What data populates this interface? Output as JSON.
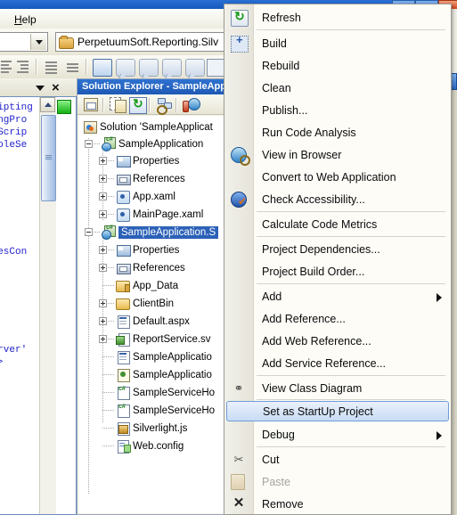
{
  "window": {
    "titlebar_buttons": [
      "minimize",
      "maximize",
      "close"
    ]
  },
  "menubar": {
    "items": [
      {
        "label": "Help",
        "accesskey": "H"
      }
    ]
  },
  "toolbar_file": {
    "combo_value": "",
    "file_icon": "folder-icon",
    "file_name": "PerpetuumSoft.Reporting.Silv"
  },
  "toolbar_icons": [
    {
      "name": "outdent-icon"
    },
    {
      "name": "indent-icon"
    },
    {
      "name": "comment-lines-icon"
    },
    {
      "name": "uncomment-icon"
    },
    {
      "name": "new-window-icon"
    },
    {
      "name": "navigate-backward-icon"
    },
    {
      "name": "navigate-forward-icon"
    },
    {
      "name": "previous-bookmark-icon"
    },
    {
      "name": "next-bookmark-icon"
    },
    {
      "name": "go-to-definition-icon"
    },
    {
      "name": "go-to-declaration-icon"
    }
  ],
  "editor": {
    "panel_caret": "dropdown-caret",
    "panel_close": "×",
    "code_lines": [
      "cripting",
      "tingPro",
      "n.Scrip",
      "gRoleSe",
      "icesCon",
      "Server'",
      "'>"
    ],
    "green_indicator": "green-status-square",
    "scroll_up": "scroll-up-arrow"
  },
  "solution_explorer": {
    "title": "Solution Explorer - SampleApp",
    "toolbar": [
      {
        "name": "properties-window-icon"
      },
      {
        "name": "show-all-files-icon"
      },
      {
        "name": "refresh-icon"
      },
      {
        "name": "view-class-diagram-icon"
      },
      {
        "name": "view-designer-icon"
      }
    ],
    "tree": [
      {
        "label": "Solution 'SampleApplicat",
        "icon": "solution-icon",
        "depth": 0,
        "expander": "none",
        "selected": false
      },
      {
        "label": "SampleApplication",
        "icon": "silverlight-project-icon",
        "depth": 1,
        "expander": "minus",
        "selected": false
      },
      {
        "label": "Properties",
        "icon": "properties-icon",
        "depth": 2,
        "expander": "plus",
        "selected": false
      },
      {
        "label": "References",
        "icon": "references-icon",
        "depth": 2,
        "expander": "plus",
        "selected": false
      },
      {
        "label": "App.xaml",
        "icon": "xaml-icon",
        "depth": 2,
        "expander": "plus",
        "selected": false
      },
      {
        "label": "MainPage.xaml",
        "icon": "xaml-icon",
        "depth": 2,
        "expander": "plus",
        "selected": false
      },
      {
        "label": "SampleApplication.S",
        "icon": "web-project-icon",
        "depth": 1,
        "expander": "minus",
        "selected": true
      },
      {
        "label": "Properties",
        "icon": "properties-icon",
        "depth": 2,
        "expander": "plus",
        "selected": false
      },
      {
        "label": "References",
        "icon": "references-icon",
        "depth": 2,
        "expander": "plus",
        "selected": false
      },
      {
        "label": "App_Data",
        "icon": "folder-icon",
        "depth": 2,
        "expander": "none",
        "selected": false
      },
      {
        "label": "ClientBin",
        "icon": "folder-icon",
        "depth": 2,
        "expander": "plus",
        "selected": false
      },
      {
        "label": "Default.aspx",
        "icon": "aspx-icon",
        "depth": 2,
        "expander": "plus",
        "selected": false
      },
      {
        "label": "ReportService.sv",
        "icon": "svc-icon",
        "depth": 2,
        "expander": "plus",
        "selected": false
      },
      {
        "label": "SampleApplicatio",
        "icon": "aspx-icon",
        "depth": 2,
        "expander": "none",
        "selected": false
      },
      {
        "label": "SampleApplicatio",
        "icon": "resource-icon",
        "depth": 2,
        "expander": "none",
        "selected": false
      },
      {
        "label": "SampleServiceHo",
        "icon": "csharp-icon",
        "depth": 2,
        "expander": "none",
        "selected": false
      },
      {
        "label": "SampleServiceHo",
        "icon": "csharp-icon",
        "depth": 2,
        "expander": "none",
        "selected": false
      },
      {
        "label": "Silverlight.js",
        "icon": "script-icon",
        "depth": 2,
        "expander": "none",
        "selected": false
      },
      {
        "label": "Web.config",
        "icon": "config-icon",
        "depth": 2,
        "expander": "none",
        "selected": false
      }
    ]
  },
  "context_menu": {
    "highlight_color": "#c8dcf5",
    "items": [
      {
        "label": "Refresh",
        "icon": "refresh-icon",
        "submenu": false,
        "disabled": false,
        "highlighted": false,
        "separator_after": true
      },
      {
        "label": "Build",
        "icon": "build-icon",
        "submenu": false,
        "disabled": false,
        "highlighted": false,
        "separator_after": false
      },
      {
        "label": "Rebuild",
        "icon": null,
        "submenu": false,
        "disabled": false,
        "highlighted": false,
        "separator_after": false
      },
      {
        "label": "Clean",
        "icon": null,
        "submenu": false,
        "disabled": false,
        "highlighted": false,
        "separator_after": false
      },
      {
        "label": "Publish...",
        "icon": null,
        "submenu": false,
        "disabled": false,
        "highlighted": false,
        "separator_after": false
      },
      {
        "label": "Run Code Analysis",
        "icon": null,
        "submenu": false,
        "disabled": false,
        "highlighted": false,
        "separator_after": false
      },
      {
        "label": "View in Browser",
        "icon": "view-browser-icon",
        "submenu": false,
        "disabled": false,
        "highlighted": false,
        "separator_after": false
      },
      {
        "label": "Convert to Web Application",
        "icon": null,
        "submenu": false,
        "disabled": false,
        "highlighted": false,
        "separator_after": false
      },
      {
        "label": "Check Accessibility...",
        "icon": "accessibility-icon",
        "submenu": false,
        "disabled": false,
        "highlighted": false,
        "separator_after": true
      },
      {
        "label": "Calculate Code Metrics",
        "icon": null,
        "submenu": false,
        "disabled": false,
        "highlighted": false,
        "separator_after": true
      },
      {
        "label": "Project Dependencies...",
        "icon": null,
        "submenu": false,
        "disabled": false,
        "highlighted": false,
        "separator_after": false
      },
      {
        "label": "Project Build Order...",
        "icon": null,
        "submenu": false,
        "disabled": false,
        "highlighted": false,
        "separator_after": true
      },
      {
        "label": "Add",
        "icon": null,
        "submenu": true,
        "disabled": false,
        "highlighted": false,
        "separator_after": false
      },
      {
        "label": "Add Reference...",
        "icon": null,
        "submenu": false,
        "disabled": false,
        "highlighted": false,
        "separator_after": false
      },
      {
        "label": "Add Web Reference...",
        "icon": null,
        "submenu": false,
        "disabled": false,
        "highlighted": false,
        "separator_after": false
      },
      {
        "label": "Add Service Reference...",
        "icon": null,
        "submenu": false,
        "disabled": false,
        "highlighted": false,
        "separator_after": true
      },
      {
        "label": "View Class Diagram",
        "icon": "class-diagram-icon",
        "submenu": false,
        "disabled": false,
        "highlighted": false,
        "separator_after": true
      },
      {
        "label": "Set as StartUp Project",
        "icon": null,
        "submenu": false,
        "disabled": false,
        "highlighted": true,
        "separator_after": false
      },
      {
        "label": "Debug",
        "icon": null,
        "submenu": true,
        "disabled": false,
        "highlighted": false,
        "separator_after": true
      },
      {
        "label": "Cut",
        "icon": "cut-icon",
        "submenu": false,
        "disabled": false,
        "highlighted": false,
        "separator_after": false
      },
      {
        "label": "Paste",
        "icon": "paste-icon",
        "submenu": false,
        "disabled": true,
        "highlighted": false,
        "separator_after": false
      },
      {
        "label": "Remove",
        "icon": "remove-icon",
        "submenu": false,
        "disabled": false,
        "highlighted": false,
        "separator_after": false
      }
    ]
  }
}
